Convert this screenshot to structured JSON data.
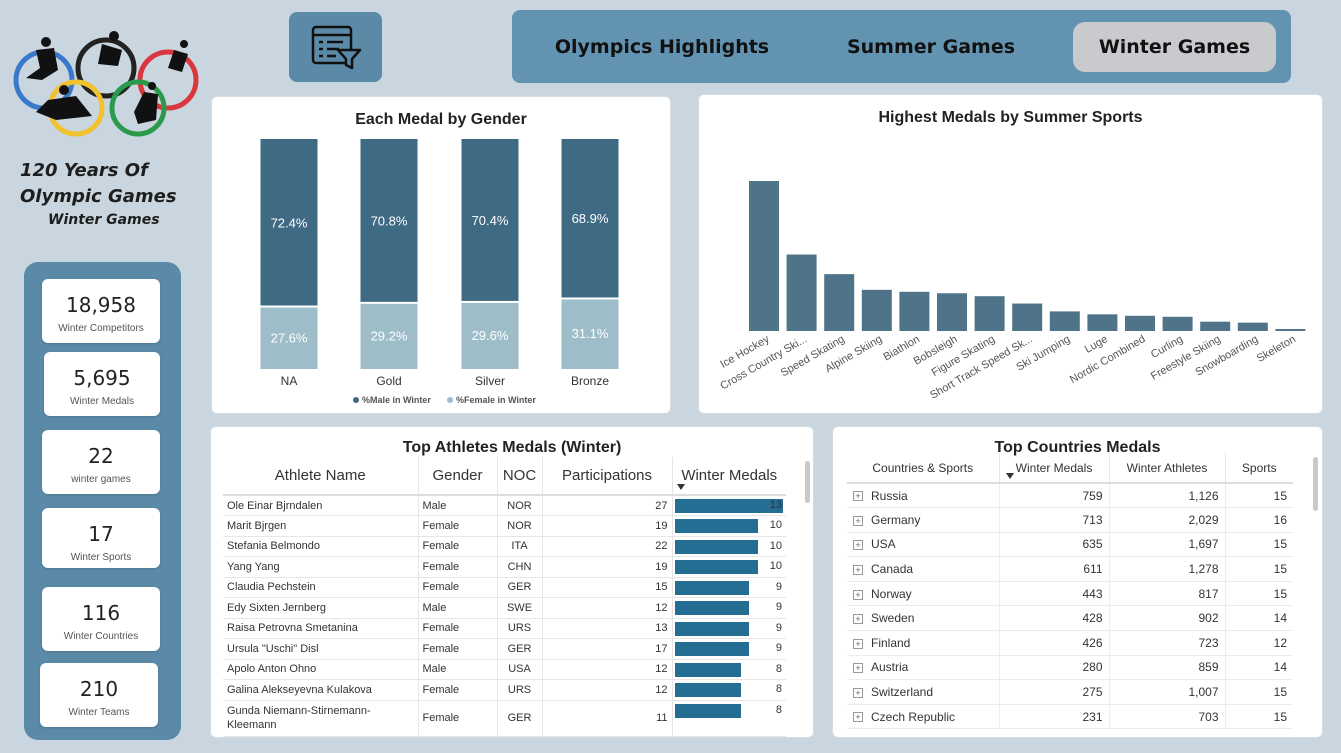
{
  "sidebar": {
    "title_line1": "120 Years Of",
    "title_line2": "Olympic Games",
    "title_line3": "Winter Games",
    "kpis": [
      {
        "value": "18,958",
        "label": "Winter Competitors"
      },
      {
        "value": "5,695",
        "label": "Winter Medals"
      },
      {
        "value": "22",
        "label": "winter games"
      },
      {
        "value": "17",
        "label": "Winter Sports"
      },
      {
        "value": "116",
        "label": "Winter Countries"
      },
      {
        "value": "210",
        "label": "Winter Teams"
      }
    ]
  },
  "nav": {
    "tabs": [
      "Olympics Highlights",
      "Summer Games",
      "Winter Games"
    ],
    "active": "Winter Games"
  },
  "colors": {
    "male": "#3e6a83",
    "female": "#9dbdc8",
    "sport_bar": "#4f7489",
    "table_bar": "#246d93",
    "panel": "#5a8aa7"
  },
  "chart_data": [
    {
      "type": "bar",
      "stacked": true,
      "title": "Each Medal by Gender",
      "categories": [
        "NA",
        "Gold",
        "Silver",
        "Bronze"
      ],
      "series": [
        {
          "name": "%Male in Winter",
          "values": [
            72.4,
            70.8,
            70.4,
            68.9
          ],
          "labels": [
            "72.4%",
            "70.8%",
            "70.4%",
            "68.9%"
          ]
        },
        {
          "name": "%Female in Winter",
          "values": [
            27.6,
            29.2,
            29.6,
            31.1
          ],
          "labels": [
            "27.6%",
            "29.2%",
            "29.6%",
            "31.1%"
          ]
        }
      ],
      "legend": "bottom",
      "ylim": [
        0,
        100
      ]
    },
    {
      "type": "bar",
      "title": "Highest Medals by Summer Sports",
      "categories": [
        "Ice Hockey",
        "Cross Country Ski...",
        "Speed Skating",
        "Alpine Skiing",
        "Biathlon",
        "Bobsleigh",
        "Figure Skating",
        "Short Track Speed Sk...",
        "Ski Jumping",
        "Luge",
        "Nordic Combined",
        "Curling",
        "Freestyle Skiing",
        "Snowboarding",
        "Skeleton"
      ],
      "values": [
        1530,
        780,
        580,
        420,
        400,
        385,
        355,
        280,
        200,
        170,
        155,
        145,
        95,
        85,
        20
      ]
    }
  ],
  "athletes": {
    "title": "Top Athletes Medals (Winter)",
    "headers": [
      "Athlete Name",
      "Gender",
      "NOC",
      "Participations",
      "Winter Medals"
    ],
    "max_medals": 13,
    "rows": [
      {
        "name": "Ole Einar Bjrndalen",
        "gender": "Male",
        "noc": "NOR",
        "participations": "27",
        "medals": 13
      },
      {
        "name": "Marit Bjrgen",
        "gender": "Female",
        "noc": "NOR",
        "participations": "19",
        "medals": 10
      },
      {
        "name": "Stefania Belmondo",
        "gender": "Female",
        "noc": "ITA",
        "participations": "22",
        "medals": 10
      },
      {
        "name": "Yang Yang",
        "gender": "Female",
        "noc": "CHN",
        "participations": "19",
        "medals": 10
      },
      {
        "name": "Claudia Pechstein",
        "gender": "Female",
        "noc": "GER",
        "participations": "15",
        "medals": 9
      },
      {
        "name": "Edy Sixten Jernberg",
        "gender": "Male",
        "noc": "SWE",
        "participations": "12",
        "medals": 9
      },
      {
        "name": "Raisa Petrovna Smetanina",
        "gender": "Female",
        "noc": "URS",
        "participations": "13",
        "medals": 9
      },
      {
        "name": "Ursula \"Uschi\" Disl",
        "gender": "Female",
        "noc": "GER",
        "participations": "17",
        "medals": 9
      },
      {
        "name": "Apolo Anton Ohno",
        "gender": "Male",
        "noc": "USA",
        "participations": "12",
        "medals": 8
      },
      {
        "name": "Galina Alekseyevna Kulakova",
        "gender": "Female",
        "noc": "URS",
        "participations": "12",
        "medals": 8
      },
      {
        "name": "Gunda Niemann-Stirnemann-Kleemann",
        "gender": "Female",
        "noc": "GER",
        "participations": "11",
        "medals": 8
      }
    ]
  },
  "countries": {
    "title": "Top Countries Medals",
    "headers": [
      "Countries & Sports",
      "Winter Medals",
      "Winter Athletes",
      "Sports"
    ],
    "rows": [
      {
        "country": "Russia",
        "medals": "759",
        "athletes": "1,126",
        "sports": "15"
      },
      {
        "country": "Germany",
        "medals": "713",
        "athletes": "2,029",
        "sports": "16"
      },
      {
        "country": "USA",
        "medals": "635",
        "athletes": "1,697",
        "sports": "15"
      },
      {
        "country": "Canada",
        "medals": "611",
        "athletes": "1,278",
        "sports": "15"
      },
      {
        "country": "Norway",
        "medals": "443",
        "athletes": "817",
        "sports": "15"
      },
      {
        "country": "Sweden",
        "medals": "428",
        "athletes": "902",
        "sports": "14"
      },
      {
        "country": "Finland",
        "medals": "426",
        "athletes": "723",
        "sports": "12"
      },
      {
        "country": "Austria",
        "medals": "280",
        "athletes": "859",
        "sports": "14"
      },
      {
        "country": "Switzerland",
        "medals": "275",
        "athletes": "1,007",
        "sports": "15"
      },
      {
        "country": "Czech Republic",
        "medals": "231",
        "athletes": "703",
        "sports": "15"
      }
    ]
  }
}
